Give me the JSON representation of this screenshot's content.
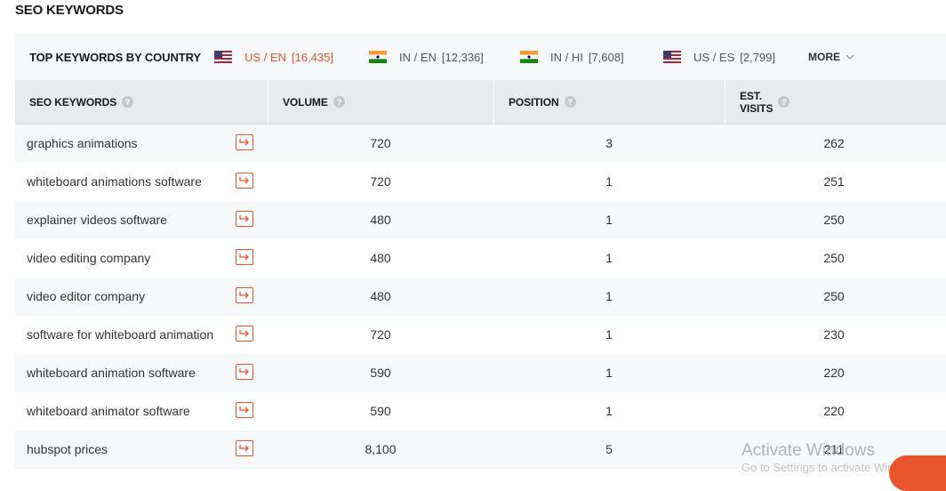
{
  "section_title": "SEO KEYWORDS",
  "country_bar": {
    "label": "TOP KEYWORDS BY COUNTRY",
    "tabs": [
      {
        "code": "US / EN",
        "count": "[16,435]",
        "flag": "us-flag-icon",
        "active": true
      },
      {
        "code": "IN / EN",
        "count": "[12,336]",
        "flag": "india-flag-icon",
        "active": false
      },
      {
        "code": "IN / HI",
        "count": "[7,608]",
        "flag": "india-flag-icon",
        "active": false
      },
      {
        "code": "US / ES",
        "count": "[2,799]",
        "flag": "us-flag-icon",
        "active": false
      }
    ],
    "more_label": "MORE"
  },
  "table": {
    "headers": {
      "keyword": "SEO KEYWORDS",
      "volume": "VOLUME",
      "position": "POSITION",
      "visits_line1": "EST.",
      "visits_line2": "VISITS"
    },
    "help_glyph": "?",
    "rows": [
      {
        "keyword": "graphics animations",
        "volume": "720",
        "position": "3",
        "visits": "262"
      },
      {
        "keyword": "whiteboard animations software",
        "volume": "720",
        "position": "1",
        "visits": "251"
      },
      {
        "keyword": "explainer videos software",
        "volume": "480",
        "position": "1",
        "visits": "250"
      },
      {
        "keyword": "video editing company",
        "volume": "480",
        "position": "1",
        "visits": "250"
      },
      {
        "keyword": "video editor company",
        "volume": "480",
        "position": "1",
        "visits": "250"
      },
      {
        "keyword": "software for whiteboard animation",
        "volume": "720",
        "position": "1",
        "visits": "230"
      },
      {
        "keyword": "whiteboard animation software",
        "volume": "590",
        "position": "1",
        "visits": "220"
      },
      {
        "keyword": "whiteboard animator software",
        "volume": "590",
        "position": "1",
        "visits": "220"
      },
      {
        "keyword": "hubspot prices",
        "volume": "8,100",
        "position": "5",
        "visits": "211"
      }
    ]
  },
  "watermark": {
    "line1": "Activate Windows",
    "line2": "Go to Settings to activate Windows."
  },
  "colors": {
    "accent": "#e8542c",
    "header_bg": "#e8eaec",
    "panel_bg": "#f7f8f9"
  }
}
